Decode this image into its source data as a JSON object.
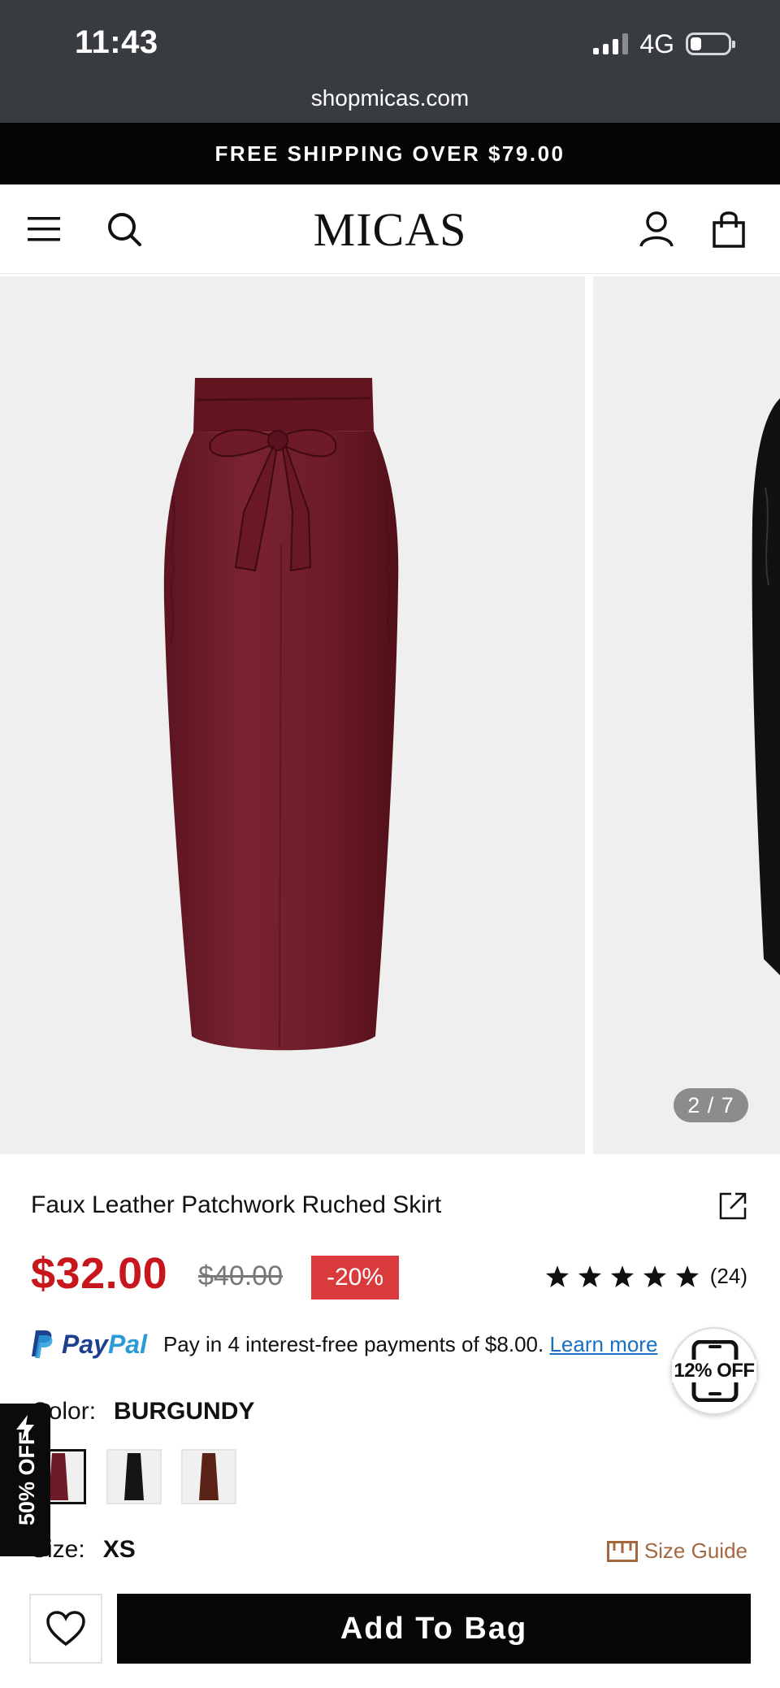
{
  "status_bar": {
    "time": "11:43",
    "network": "4G"
  },
  "browser": {
    "url": "shopmicas.com"
  },
  "promo": {
    "text": "FREE SHIPPING OVER $79.00"
  },
  "header": {
    "logo": "MICAS"
  },
  "gallery": {
    "counter": "2 / 7"
  },
  "product": {
    "title": "Faux Leather Patchwork Ruched Skirt",
    "price": "$32.00",
    "compare_price": "$40.00",
    "discount": "-20%",
    "rating_stars": 5,
    "review_count": "(24)"
  },
  "paypal": {
    "brand_pay": "Pay",
    "brand_pal": "Pal",
    "message": "Pay in 4 interest-free payments of $8.00. ",
    "link": "Learn more"
  },
  "app_badge": {
    "text": "12% OFF"
  },
  "color": {
    "label": "Color:",
    "value": "BURGUNDY",
    "swatches": [
      "burgundy",
      "black",
      "brown"
    ]
  },
  "size": {
    "label": "Size:",
    "value": "XS",
    "guide": "Size Guide"
  },
  "side_promo": {
    "text": "50% OFF"
  },
  "actions": {
    "add_to_bag": "Add To Bag"
  },
  "colors": {
    "price_red": "#c8161d",
    "discount_bg": "#d93b3d",
    "burgundy": "#6e1b27",
    "brand_tan": "#a5683e"
  }
}
